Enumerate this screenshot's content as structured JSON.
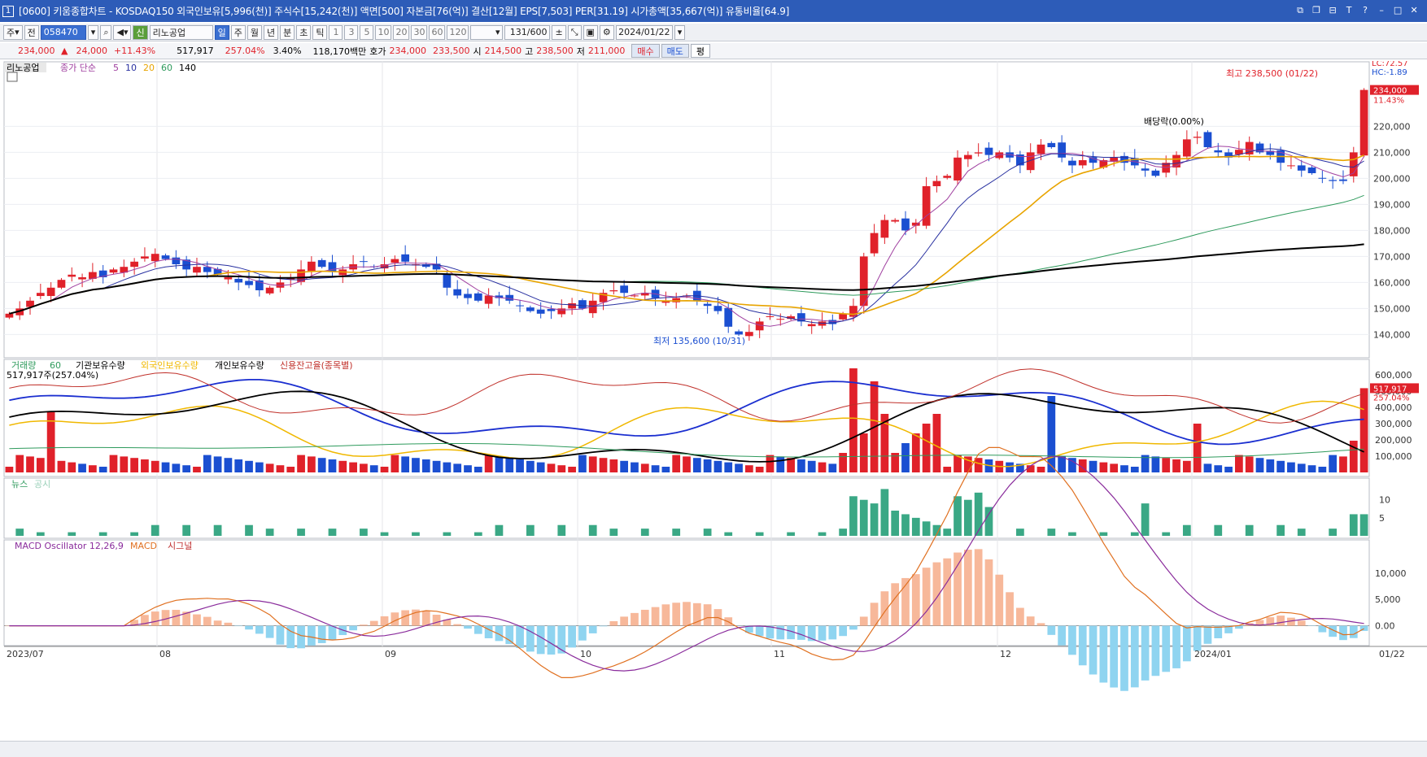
{
  "title": {
    "num": "1",
    "text": "[0600] 키움종합차트 - KOSDAQ150 외국인보유[5,996(천)] 주식수[15,242(천)] 액면[500] 자본금[76(억)] 결산[12월] EPS[7,503] PER[31.19] 시가총액[35,667(억)] 유통비율[64.9]"
  },
  "toolbar": {
    "market": "주",
    "all": "전",
    "code": "058470",
    "stock_name": "리노공업",
    "credit_badge": "신",
    "periods": [
      "일",
      "주",
      "월",
      "년",
      "분",
      "초",
      "틱"
    ],
    "active_period": "일",
    "minutes": [
      "1",
      "3",
      "5",
      "10",
      "20",
      "30",
      "60",
      "120"
    ],
    "count": "131",
    "total": "/600",
    "date": "2024/01/22"
  },
  "pricebar": {
    "price": "234,000",
    "change": "24,000",
    "change_pct": "+11.43%",
    "volume": "517,917",
    "vol_ratio": "257.04%",
    "turnover": "3.40%",
    "amount": "118,170백만",
    "quote_label": "호가",
    "ask": "234,000",
    "bid": "233,500",
    "open_label": "시",
    "open": "214,500",
    "high_label": "고",
    "high": "238,500",
    "low_label": "저",
    "low": "211,000",
    "buy": "매수",
    "sell": "매도",
    "avg": "평"
  },
  "colors": {
    "up": "#e0212a",
    "down": "#1b4fd1",
    "ma5": "#a040a0",
    "ma10": "#2830a0",
    "ma20": "#e8a400",
    "ma60": "#2e9a5c",
    "ma140": "#000000"
  },
  "price_panel": {
    "legend_name": "리노공업",
    "legend_ma": "종가 단순",
    "ma_periods": [
      "5",
      "10",
      "20",
      "60",
      "140"
    ],
    "lc": "LC:72.57",
    "hc": "HC:-1.89",
    "last_price": "234,000",
    "last_pct": "11.43%",
    "high_note": "최고 238,500 (01/22)",
    "low_note": "최저 135,600 (10/31)",
    "dividend_note": "배당락(0.00%)",
    "y_ticks": [
      "140,000",
      "150,000",
      "160,000",
      "170,000",
      "180,000",
      "190,000",
      "200,000",
      "210,000",
      "220,000"
    ]
  },
  "volume_panel": {
    "legend": [
      "거래량",
      "60",
      "기관보유수량",
      "외국인보유수량",
      "개인보유수량",
      "신용잔고율(종목별)"
    ],
    "sub": "517,917주(257.04%)",
    "last_vol": "517,917",
    "last_pct": "257.04%",
    "y_ticks": [
      "100,000",
      "200,000",
      "300,000",
      "400,000",
      "500,000",
      "600,000"
    ]
  },
  "news_panel": {
    "legend": [
      "뉴스",
      "공시"
    ],
    "y_ticks": [
      "5",
      "10"
    ]
  },
  "macd_panel": {
    "legend": [
      "MACD Oscillator 12,26,9",
      "MACD",
      "시그널"
    ],
    "y_ticks": [
      "0.00",
      "5,000",
      "10,000"
    ]
  },
  "x_axis": {
    "labels": [
      "2023/07",
      "08",
      "09",
      "10",
      "11",
      "12",
      "2024/01"
    ],
    "right_label": "01/22"
  },
  "chart_data": {
    "type": "candlestick",
    "ohlc_note": "daily prices in KRW, 2023/07 – 2024/01/22",
    "ylim": [
      132000,
      242000
    ],
    "closes": [
      148000,
      150000,
      153000,
      156000,
      158000,
      161000,
      163000,
      162000,
      164000,
      162000,
      165000,
      166000,
      168000,
      170000,
      171000,
      169000,
      167000,
      165000,
      166000,
      164000,
      163000,
      162000,
      160000,
      159000,
      157000,
      158000,
      160000,
      162000,
      165000,
      168000,
      166000,
      164000,
      165000,
      167000,
      168000,
      166000,
      167000,
      169000,
      168000,
      167000,
      166000,
      165000,
      158000,
      155000,
      154000,
      153000,
      155000,
      154000,
      153000,
      151000,
      149000,
      148000,
      149000,
      150000,
      152000,
      150000,
      153000,
      156000,
      157000,
      156000,
      155000,
      156000,
      154000,
      153000,
      154000,
      155000,
      153000,
      151000,
      149000,
      143000,
      140000,
      141000,
      145000,
      147000,
      146000,
      147000,
      145000,
      144000,
      145000,
      144000,
      148000,
      151000,
      170000,
      179000,
      184000,
      184000,
      180000,
      183000,
      197000,
      199000,
      201000,
      208000,
      209000,
      210000,
      209000,
      210000,
      208000,
      205000,
      210000,
      213000,
      212000,
      208000,
      205000,
      207000,
      206000,
      207000,
      208000,
      206000,
      205000,
      203000,
      201000,
      206000,
      209000,
      215000,
      216000,
      212000,
      210000,
      208000,
      211000,
      214000,
      210000,
      209000,
      206000,
      205000,
      203000,
      202000,
      200000,
      199000,
      199000,
      210000,
      234000
    ]
  }
}
